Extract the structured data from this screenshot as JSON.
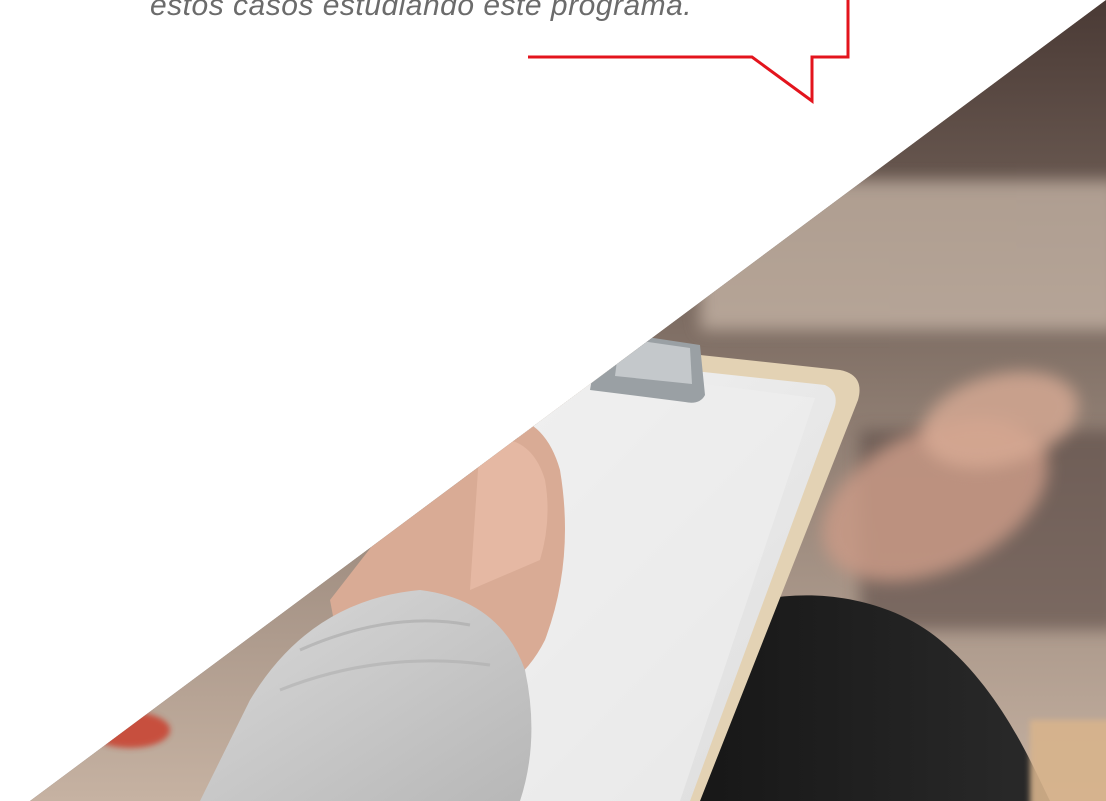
{
  "quote": {
    "text": "estos casos estudiando este programa."
  },
  "colors": {
    "accent": "#e3141d",
    "quote_text": "#6b6b6b",
    "background": "#ffffff"
  },
  "photo": {
    "subject": "hand-holding-clipboard"
  }
}
